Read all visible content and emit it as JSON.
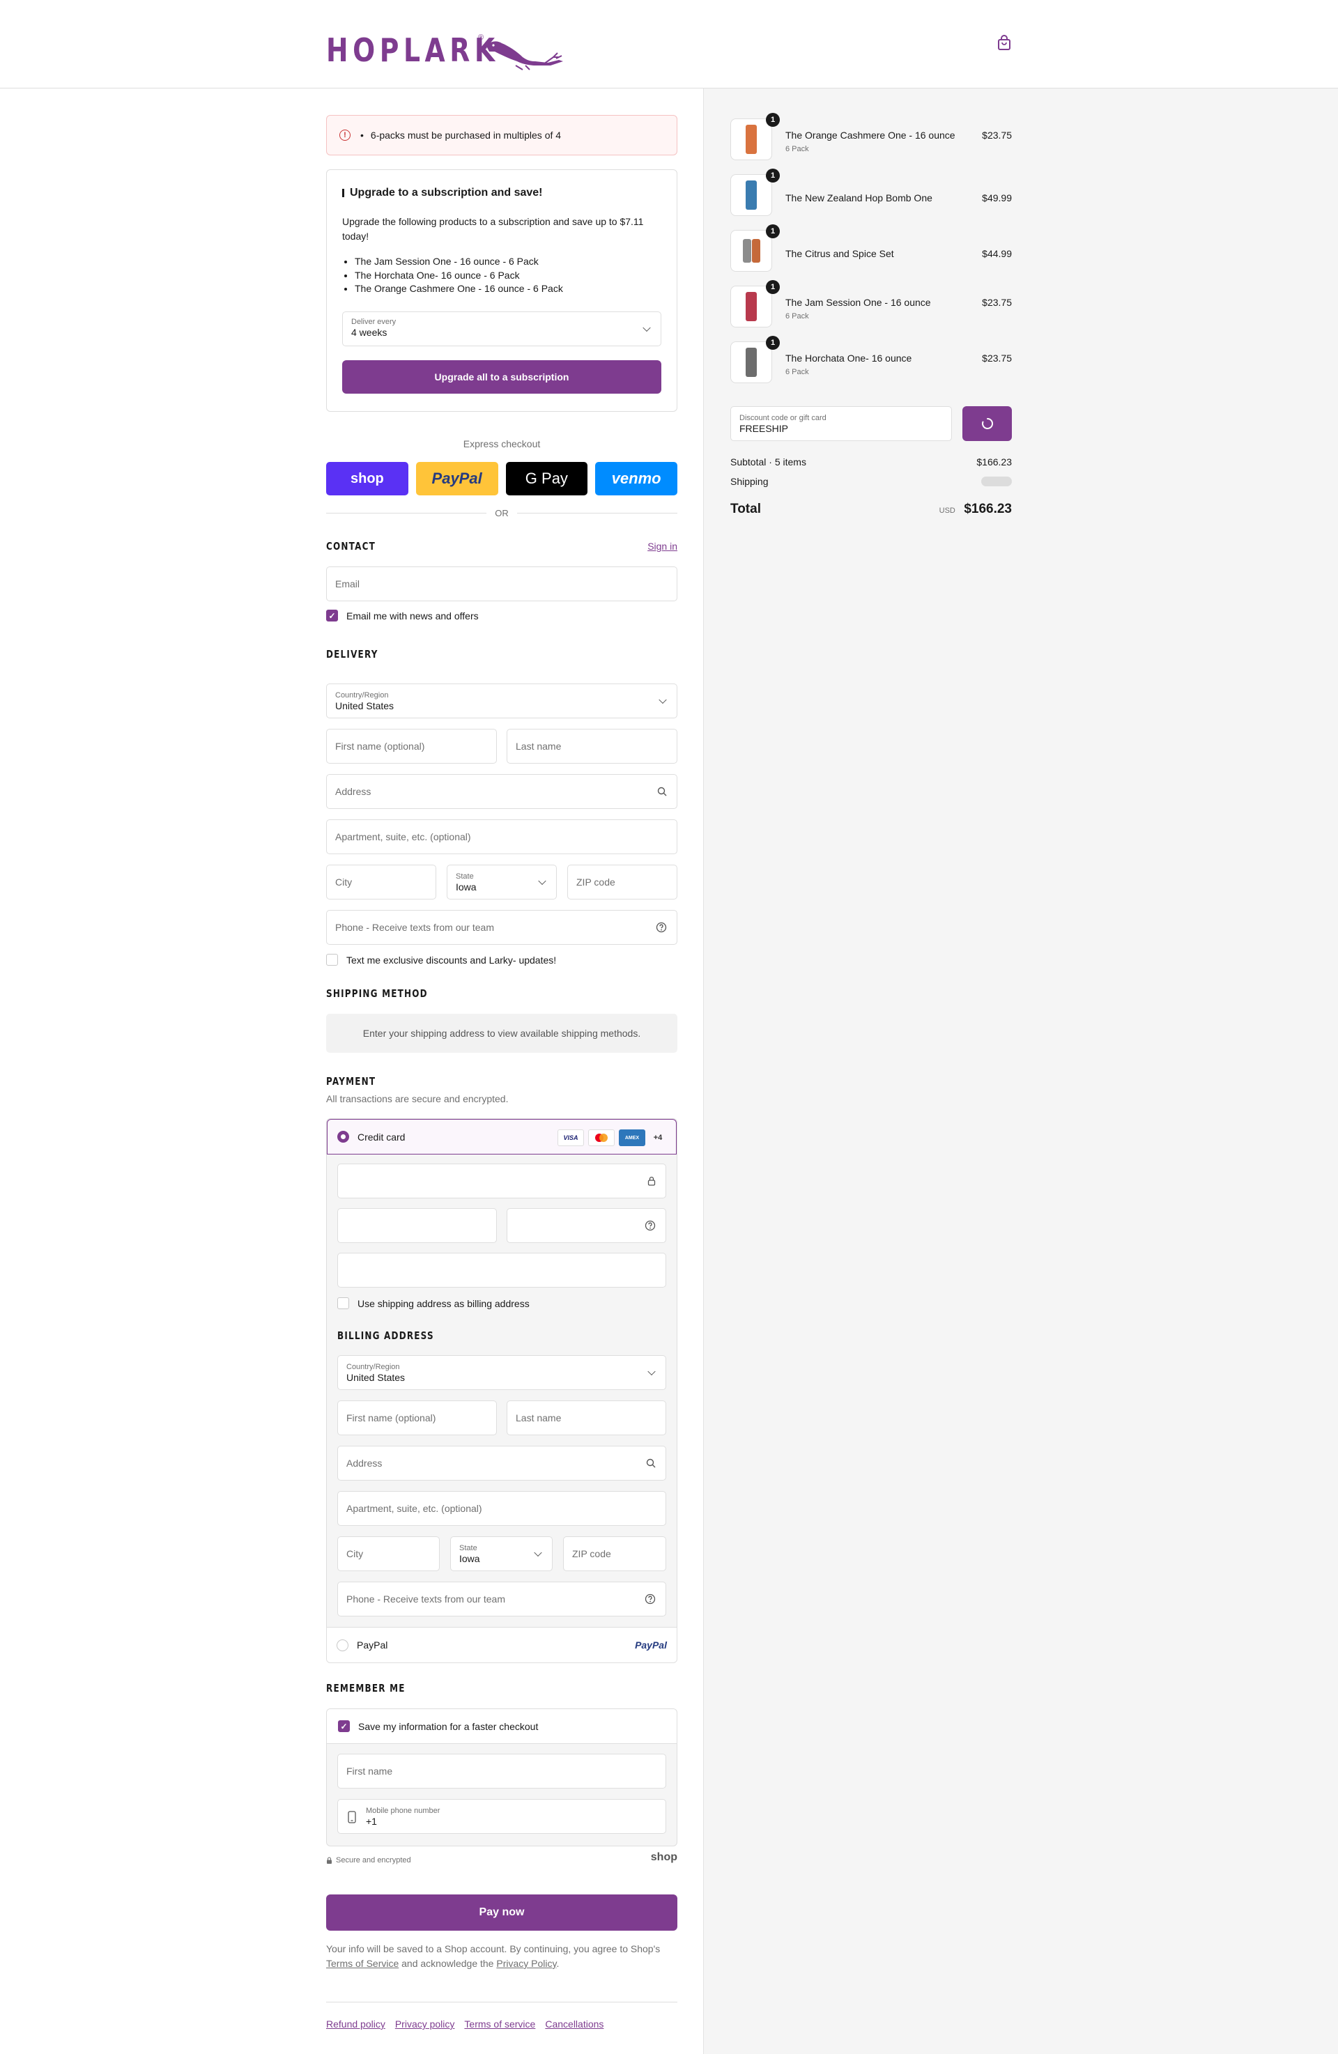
{
  "brand": {
    "name": "HOPLARK",
    "reg": "®"
  },
  "alert": {
    "message": "6-packs must be purchased in multiples of 4"
  },
  "upgrade": {
    "title": "Upgrade to a subscription and save!",
    "body": "Upgrade the following products to a subscription and save up to $7.11 today!",
    "products": [
      "The Jam Session One - 16 ounce - 6 Pack",
      "The Horchata One- 16 ounce - 6 Pack",
      "The Orange Cashmere One - 16 ounce - 6 Pack"
    ],
    "deliver_label": "Deliver every",
    "deliver_value": "4 weeks",
    "button": "Upgrade all to a subscription"
  },
  "express": {
    "title": "Express checkout",
    "buttons": [
      "shop",
      "PayPal",
      "G Pay",
      "venmo"
    ],
    "or": "OR"
  },
  "contact": {
    "title": "CONTACT",
    "sign_in": "Sign in",
    "email_placeholder": "Email",
    "news_label": "Email me with news and offers"
  },
  "delivery": {
    "title": "DELIVERY",
    "country_label": "Country/Region",
    "country_value": "United States",
    "first_name": "First name (optional)",
    "last_name": "Last name",
    "address": "Address",
    "apartment": "Apartment, suite, etc. (optional)",
    "city": "City",
    "state_label": "State",
    "state_value": "Iowa",
    "zip": "ZIP code",
    "phone": "Phone - Receive texts from our team",
    "sms_label": "Text me exclusive discounts and Larky- updates!"
  },
  "shipping": {
    "title": "SHIPPING METHOD",
    "info": "Enter your shipping address to view available shipping methods."
  },
  "payment": {
    "title": "PAYMENT",
    "subtitle": "All transactions are secure and encrypted.",
    "credit_card": "Credit card",
    "card_brands": [
      "VISA",
      "MC",
      "AMEX",
      "+4"
    ],
    "billing_same": "Use shipping address as billing address",
    "billing_title": "BILLING ADDRESS",
    "paypal": "PayPal",
    "paypal_logo": "PayPal"
  },
  "remember": {
    "title": "REMEMBER ME",
    "save_label": "Save my information for a faster checkout",
    "first_name": "First name",
    "mobile_label": "Mobile phone number",
    "mobile_value": "+1",
    "secure": "Secure and encrypted",
    "shop": "shop"
  },
  "pay_now": "Pay now",
  "legal": {
    "prefix": "Your info will be saved to a Shop account. By continuing, you agree to Shop's",
    "tos": "Terms of Service",
    "mid": "and acknowledge the",
    "privacy": "Privacy Policy",
    "end": "."
  },
  "footer_links": [
    "Refund policy",
    "Privacy policy",
    "Terms of service",
    "Cancellations"
  ],
  "order": {
    "items": [
      {
        "name": "The Orange Cashmere One - 16 ounce",
        "variant": "6 Pack",
        "price": "$23.75",
        "qty": "1",
        "color": "#d9733f"
      },
      {
        "name": "The New Zealand Hop Bomb One",
        "variant": "",
        "price": "$49.99",
        "qty": "1",
        "color": "#3a7cb0"
      },
      {
        "name": "The Citrus and Spice Set",
        "variant": "",
        "price": "$44.99",
        "qty": "1",
        "color": "#c5693a"
      },
      {
        "name": "The Jam Session One - 16 ounce",
        "variant": "6 Pack",
        "price": "$23.75",
        "qty": "1",
        "color": "#b8394d"
      },
      {
        "name": "The Horchata One- 16 ounce",
        "variant": "6 Pack",
        "price": "$23.75",
        "qty": "1",
        "color": "#6d6d6d"
      }
    ],
    "discount_label": "Discount code or gift card",
    "discount_value": "FREESHIP",
    "subtotal_label": "Subtotal · 5 items",
    "subtotal_value": "$166.23",
    "shipping_label": "Shipping",
    "total_label": "Total",
    "currency": "USD",
    "total_value": "$166.23"
  },
  "colors": {
    "accent": "#7e3c8f",
    "error": "#c93535"
  }
}
